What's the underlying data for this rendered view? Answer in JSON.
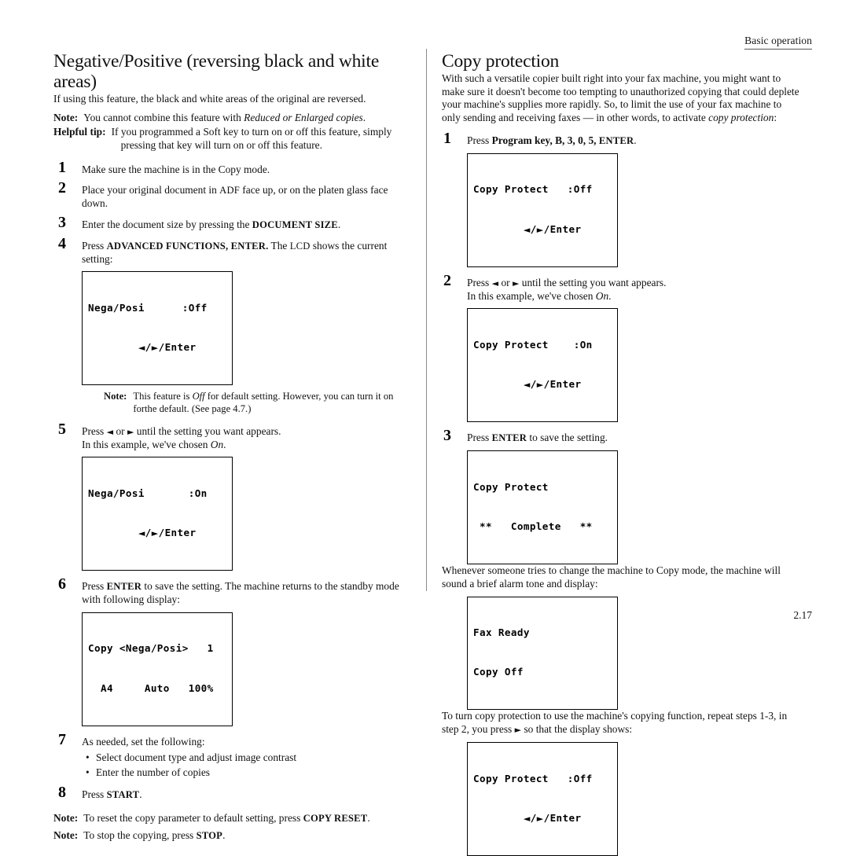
{
  "header": {
    "running_head": "Basic operation"
  },
  "footer": {
    "page_number": "2.17"
  },
  "left_column": {
    "title": "Negative/Positive (reversing black and white areas)",
    "intro": "If using this feature, the black and white areas of the original are reversed.",
    "note_label": "Note:",
    "note_text_a": "You cannot combine this feature with ",
    "note_text_italic": "Reduced or Enlarged copies",
    "note_text_b": ".",
    "tip_label": "Helpful tip:",
    "tip_text_line1": "If you programmed a Soft key to turn on or off this feature, simply",
    "tip_text_line2": "pressing that key will turn on or off this feature.",
    "steps": [
      {
        "num": "1",
        "text": "Make sure the machine is in the Copy mode."
      },
      {
        "num": "2",
        "text_a": "Place your original document in ",
        "key": "ADF",
        "text_b": " face up, or on the platen glass face down."
      },
      {
        "num": "3",
        "text_a": "Enter the document size by pressing the ",
        "key": "DOCUMENT SIZE",
        "text_b": "."
      },
      {
        "num": "4",
        "text_a": "Press ",
        "key": "ADVANCED FUNCTIONS, ENTER.",
        "text_b": " The ",
        "key2": "LCD",
        "text_c": " shows the current setting:"
      },
      {
        "num": "5",
        "line1_a": "Press ",
        "line1_left_arrow": "◄",
        "line1_b": " or ",
        "line1_right_arrow": "►",
        "line1_c": " until the setting you want appears.",
        "line2_a": "In this example, we've chosen ",
        "line2_italic": "On",
        "line2_b": "."
      },
      {
        "num": "6",
        "text_a": "Press ",
        "key": "ENTER",
        "text_b": " to save the setting. The machine returns to the standby mode with following display:"
      },
      {
        "num": "7",
        "text": "As needed, set the following:",
        "bullets": [
          "Select document type and adjust image contrast",
          "Enter the number of copies"
        ]
      },
      {
        "num": "8",
        "text_a": "Press ",
        "key": "START",
        "text_b": "."
      }
    ],
    "step4_note_label": "Note:",
    "step4_note_line1": "This feature is ",
    "step4_note_italic": "Off",
    "step4_note_line1b": " for default setting.  However, you can turn it on for",
    "step4_note_line2": "the default. (See page 4.7.)",
    "lcd_nega_off": {
      "line1": "Nega/Posi      :Off",
      "line2_prefix": "        ",
      "line2_left_arrow": "◄",
      "line2_mid": "/",
      "line2_right_arrow": "►",
      "line2_suffix": "/Enter"
    },
    "lcd_nega_on": {
      "line1": "Nega/Posi       :On",
      "line2_prefix": "        ",
      "line2_left_arrow": "◄",
      "line2_mid": "/",
      "line2_right_arrow": "►",
      "line2_suffix": "/Enter"
    },
    "lcd_standby": {
      "line1": "Copy <Nega/Posi>   1",
      "line2": "  A4     Auto   100%"
    },
    "end_notes": [
      {
        "label": "Note:",
        "text_a": "To reset the copy parameter to default setting, press ",
        "key": "COPY RESET",
        "text_b": "."
      },
      {
        "label": "Note:",
        "text_a": "To stop the copying, press ",
        "key": "STOP",
        "text_b": "."
      }
    ]
  },
  "right_column": {
    "title": "Copy protection",
    "intro_a": "With such a versatile copier built right into your fax machine, you might want to make sure it doesn't become too tempting to unauthorized copying that could deplete your machine's supplies more rapidly. So, to limit the use of your fax machine to only sending and receiving faxes — in other words, to activate ",
    "intro_italic": "copy protection",
    "intro_b": ":",
    "steps": [
      {
        "num": "1",
        "text_a": "Press ",
        "key_bold": "Program key, B, 3, 0, 5,",
        "text_b": " ",
        "key_sc": "ENTER",
        "text_c": "."
      },
      {
        "num": "2",
        "line1_a": "Press ",
        "line1_left_arrow": "◄",
        "line1_b": " or ",
        "line1_right_arrow": "►",
        "line1_c": " until the setting you want appears.",
        "line2_a": "In this example, we've chosen ",
        "line2_italic": "On",
        "line2_b": "."
      },
      {
        "num": "3",
        "text_a": "Press ",
        "key": "ENTER",
        "text_b": " to save the setting."
      }
    ],
    "lcd_protect_off": {
      "line1": "Copy Protect   :Off",
      "line2_prefix": "        ",
      "line2_left_arrow": "◄",
      "line2_mid": "/",
      "line2_right_arrow": "►",
      "line2_suffix": "/Enter"
    },
    "lcd_protect_on": {
      "line1": "Copy Protect    :On",
      "line2_prefix": "        ",
      "line2_left_arrow": "◄",
      "line2_mid": "/",
      "line2_right_arrow": "►",
      "line2_suffix": "/Enter"
    },
    "lcd_complete": {
      "line1": "Copy Protect",
      "line2": " **   Complete   **"
    },
    "lcd_fax_ready": {
      "line1": "Fax Ready",
      "line2": "Copy Off"
    },
    "lcd_protect_off2": {
      "line1": "Copy Protect   :Off",
      "line2_prefix": "        ",
      "line2_left_arrow": "◄",
      "line2_mid": "/",
      "line2_right_arrow": "►",
      "line2_suffix": "/Enter"
    },
    "alarm_para": "Whenever someone tries to change the machine to Copy mode, the machine will sound a brief alarm tone and display:",
    "turnoff_para_a": "To turn copy protection to use the machine's copying function, repeat steps 1-3, in step 2, you press ",
    "turnoff_arrow": "►",
    "turnoff_para_b": " so that the display shows:"
  }
}
